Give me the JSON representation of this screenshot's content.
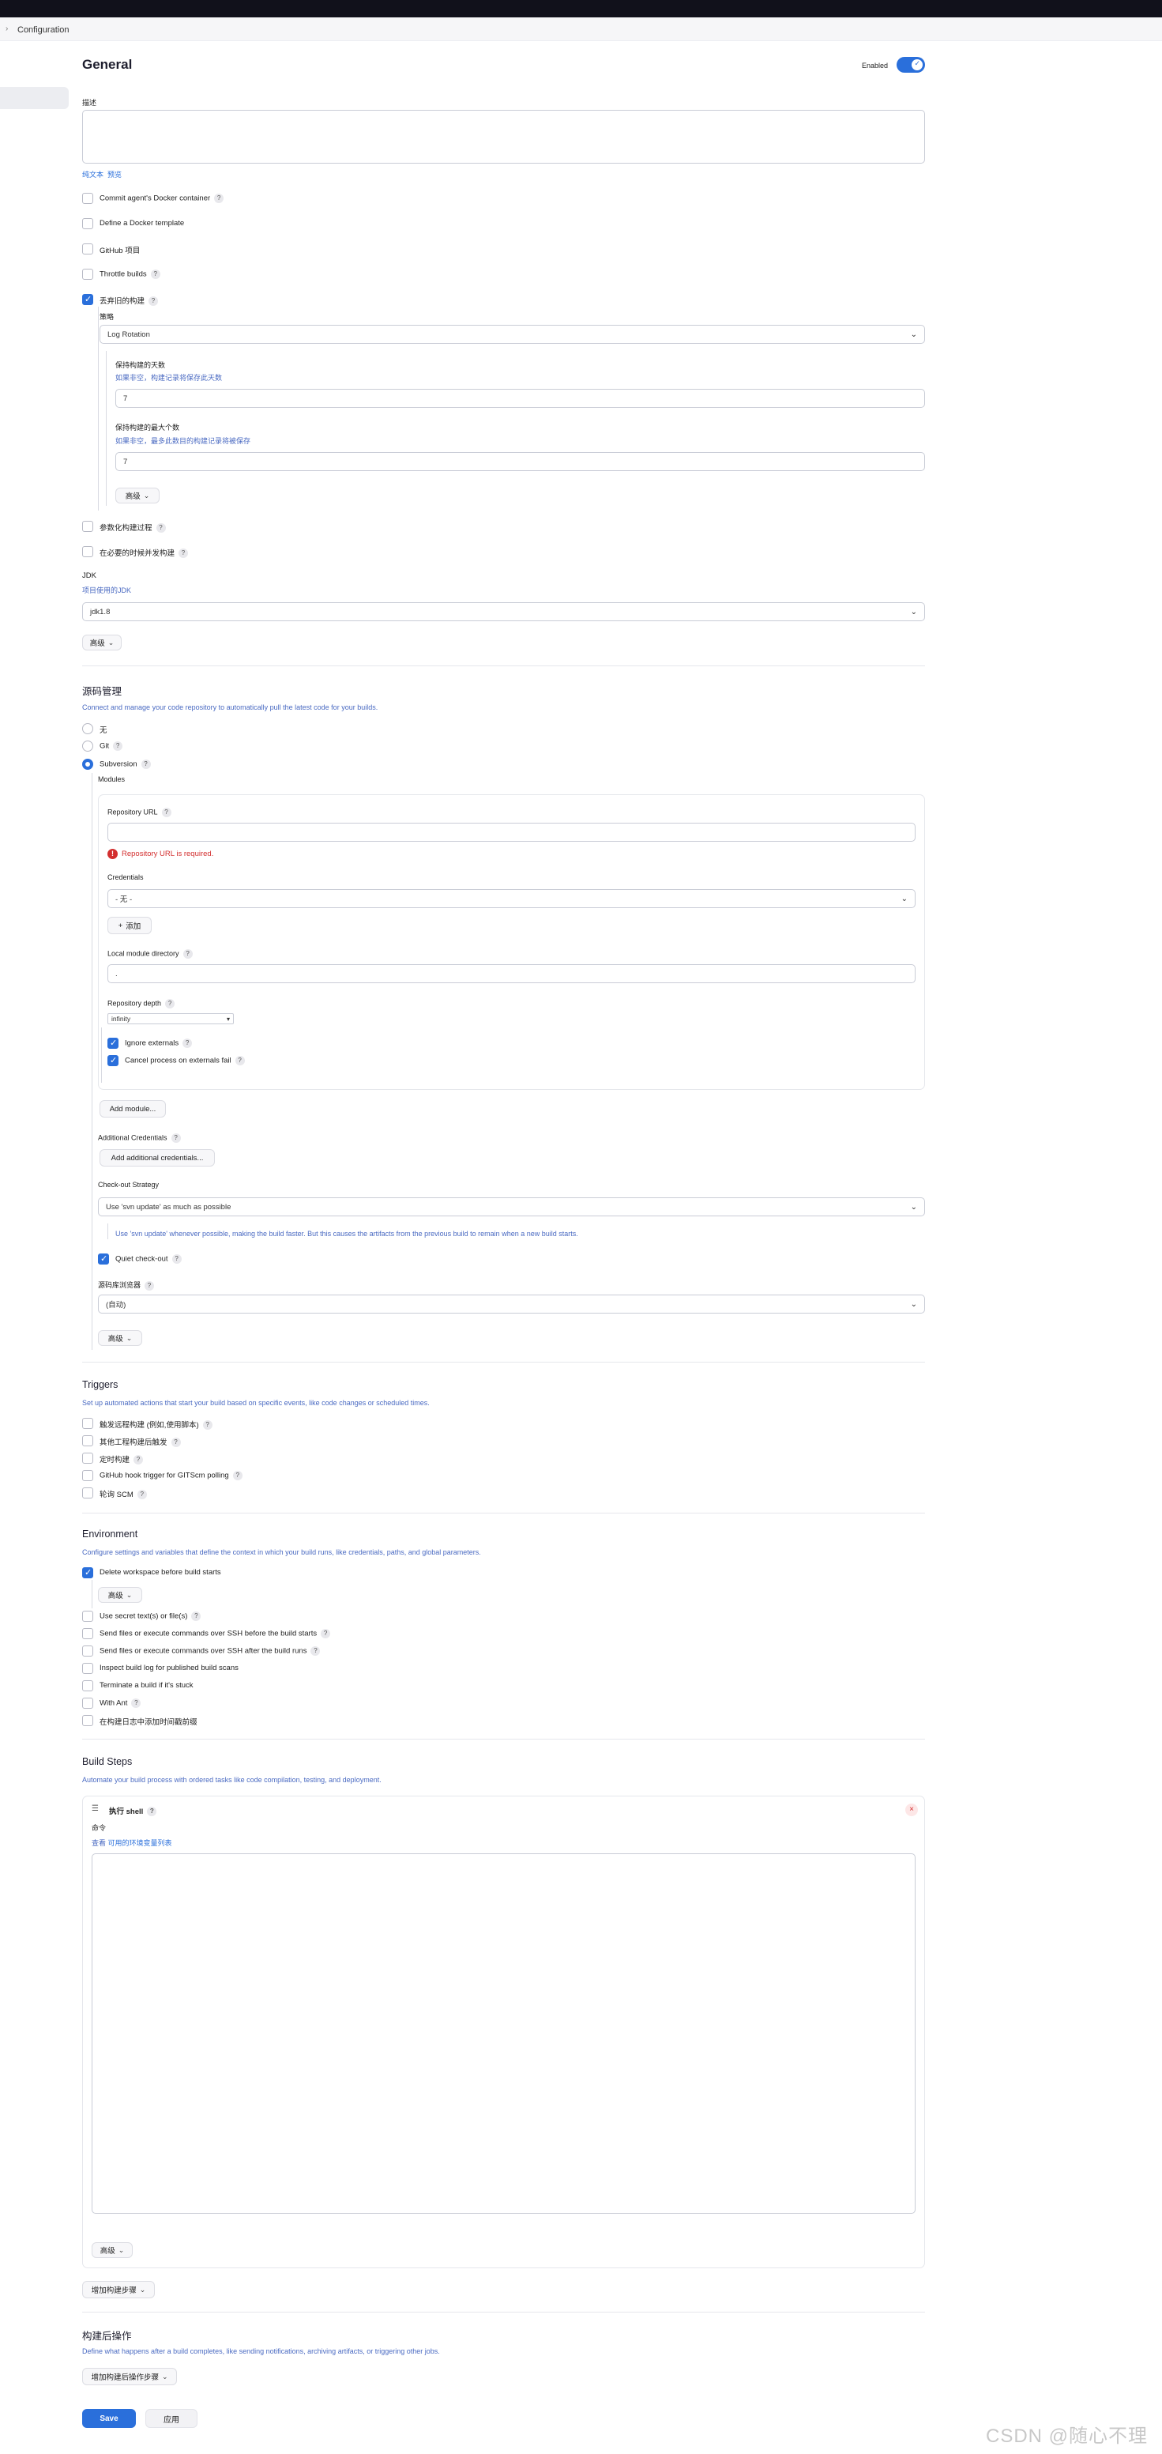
{
  "header": {
    "breadcrumb": "Configuration"
  },
  "general": {
    "title": "General",
    "enabled_label": "Enabled",
    "enabled": true,
    "description_label": "描述",
    "description_value": "",
    "plain_text": "纯文本",
    "preview": "预览",
    "options": [
      {
        "label": "Commit agent's Docker container",
        "checked": false,
        "help": true
      },
      {
        "label": "Define a Docker template",
        "checked": false,
        "help": false
      },
      {
        "label": "GitHub 项目",
        "checked": false,
        "help": false
      },
      {
        "label": "Throttle builds",
        "checked": false,
        "help": true
      },
      {
        "label": "丢弃旧的构建",
        "checked": true,
        "help": true
      }
    ],
    "discard": {
      "strategy_label": "策略",
      "strategy_value": "Log Rotation",
      "days_label": "保持构建的天数",
      "days_hint": "如果非空，构建记录将保存此天数",
      "days_value": "7",
      "max_label": "保持构建的最大个数",
      "max_hint": "如果非空，最多此数目的构建记录将被保存",
      "max_value": "7",
      "advanced": "高级"
    },
    "options2": [
      {
        "label": "参数化构建过程",
        "checked": false,
        "help": true
      },
      {
        "label": "在必要的时候并发构建",
        "checked": false,
        "help": true
      }
    ],
    "jdk_label": "JDK",
    "jdk_hint": "项目使用的JDK",
    "jdk_value": "jdk1.8",
    "advanced": "高级"
  },
  "scm": {
    "title": "源码管理",
    "subtitle": "Connect and manage your code repository to automatically pull the latest code for your builds.",
    "none": "无",
    "git": "Git",
    "svn": "Subversion",
    "selected": "Subversion",
    "modules_label": "Modules",
    "repo_url_label": "Repository URL",
    "repo_url_value": "",
    "repo_url_error": "Repository URL is required.",
    "credentials_label": "Credentials",
    "credentials_value": "- 无 -",
    "add_button": "添加",
    "local_dir_label": "Local module directory",
    "local_dir_value": ".",
    "depth_label": "Repository depth",
    "depth_value": "infinity",
    "ignore_externals": "Ignore externals",
    "cancel_externals": "Cancel process on externals fail",
    "add_module": "Add module...",
    "additional_credentials_label": "Additional Credentials",
    "add_additional_credentials": "Add additional credentials...",
    "checkout_label": "Check-out Strategy",
    "checkout_value": "Use 'svn update' as much as possible",
    "checkout_desc": "Use 'svn update' whenever possible, making the build faster. But this causes the artifacts from the previous build to remain when a new build starts.",
    "quiet_checkout": "Quiet check-out",
    "browser_label": "源码库浏览器",
    "browser_value": "(自动)",
    "advanced": "高级"
  },
  "triggers": {
    "title": "Triggers",
    "subtitle": "Set up automated actions that start your build based on specific events, like code changes or scheduled times.",
    "items": [
      {
        "label": "触发远程构建 (例如,使用脚本)",
        "help": true
      },
      {
        "label": "其他工程构建后触发",
        "help": true
      },
      {
        "label": "定时构建",
        "help": true
      },
      {
        "label": "GitHub hook trigger for GITScm polling",
        "help": true
      },
      {
        "label": "轮询 SCM",
        "help": true
      }
    ]
  },
  "environment": {
    "title": "Environment",
    "subtitle": "Configure settings and variables that define the context in which your build runs, like credentials, paths, and global parameters.",
    "delete_workspace": "Delete workspace before build starts",
    "advanced": "高级",
    "items": [
      {
        "label": "Use secret text(s) or file(s)",
        "help": true
      },
      {
        "label": "Send files or execute commands over SSH before the build starts",
        "help": true
      },
      {
        "label": "Send files or execute commands over SSH after the build runs",
        "help": true
      },
      {
        "label": "Inspect build log for published build scans",
        "help": false
      },
      {
        "label": "Terminate a build if it's stuck",
        "help": false
      },
      {
        "label": "With Ant",
        "help": true
      },
      {
        "label": "在构建日志中添加时间戳前缀",
        "help": false
      }
    ]
  },
  "build": {
    "title": "Build Steps",
    "subtitle": "Automate your build process with ordered tasks like code compilation, testing, and deployment.",
    "step_title": "执行 shell",
    "command_label": "命令",
    "command_hint_prefix": "查看",
    "command_hint_link": "可用的环境变量列表",
    "command_value": "",
    "advanced": "高级",
    "add_step": "增加构建步骤"
  },
  "post": {
    "title": "构建后操作",
    "subtitle": "Define what happens after a build completes, like sending notifications, archiving artifacts, or triggering other jobs.",
    "add_step": "增加构建后操作步骤"
  },
  "footer": {
    "save": "Save",
    "apply": "应用"
  },
  "watermark": "CSDN @随心不理",
  "colors": {
    "accent": "#2a6fdb",
    "error": "#d32f2f",
    "link": "#4a6ac2"
  }
}
